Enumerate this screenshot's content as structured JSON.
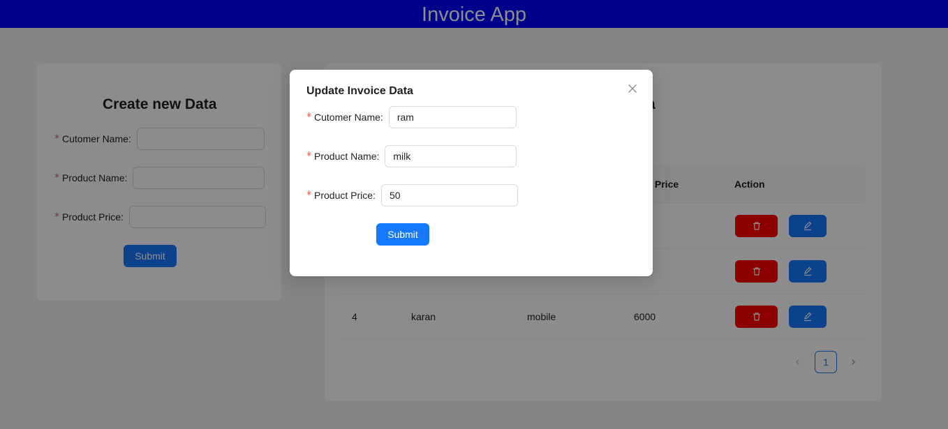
{
  "app": {
    "title": "Invoice App"
  },
  "colors": {
    "header_bg": "#0000ff",
    "primary": "#1677ff",
    "danger": "#ff0000",
    "required": "#ff4d4f"
  },
  "create_form": {
    "title": "Create new Data",
    "customer_label": "Cutomer Name",
    "product_label": "Product Name",
    "price_label": "Product Price",
    "customer_value": "",
    "product_value": "",
    "price_value": "",
    "submit_label": "Submit"
  },
  "list": {
    "title_fragment": "a",
    "columns": {
      "price": "uct Price",
      "action": "Action"
    },
    "rows": [
      {
        "id": "",
        "customer": "",
        "product": "",
        "price": ""
      },
      {
        "id": "",
        "customer": "",
        "product": "",
        "price": ""
      },
      {
        "id": "4",
        "customer": "karan",
        "product": "mobile",
        "price": "6000"
      }
    ],
    "icons": {
      "delete": "trash-icon",
      "edit": "pencil-icon"
    }
  },
  "pagination": {
    "current": "1",
    "prev_icon": "chevron-left-icon",
    "next_icon": "chevron-right-icon"
  },
  "modal": {
    "title": "Update Invoice Data",
    "customer_label": "Cutomer Name",
    "product_label": "Product Name",
    "price_label": "Product Price",
    "customer_value": "ram",
    "product_value": "milk",
    "price_value": "50",
    "submit_label": "Submit",
    "close_icon": "close-icon"
  }
}
